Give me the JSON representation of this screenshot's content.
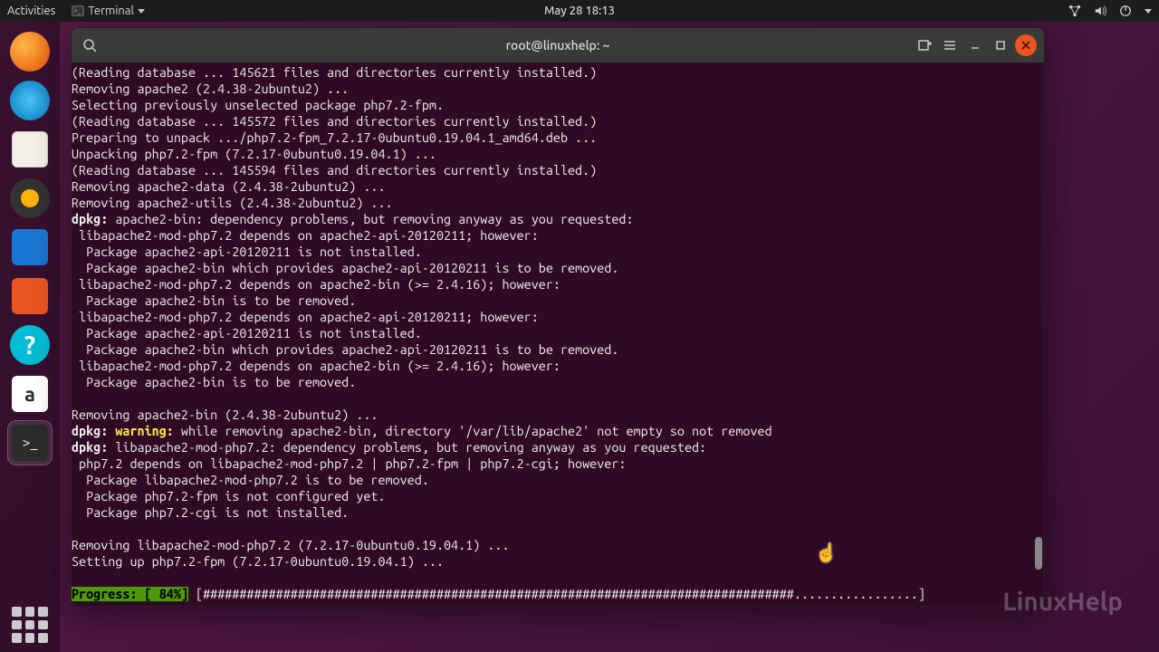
{
  "topbar": {
    "activities": "Activities",
    "app_name": "Terminal",
    "datetime": "May 28  18:13"
  },
  "dock": {
    "help_glyph": "?",
    "amazon_glyph": "a",
    "term_glyph": ">_"
  },
  "terminal": {
    "title": "root@linuxhelp: ~",
    "lines": {
      "l01": "(Reading database ... 145621 files and directories currently installed.)",
      "l02": "Removing apache2 (2.4.38-2ubuntu2) ...",
      "l03": "Selecting previously unselected package php7.2-fpm.",
      "l04": "(Reading database ... 145572 files and directories currently installed.)",
      "l05": "Preparing to unpack .../php7.2-fpm_7.2.17-0ubuntu0.19.04.1_amd64.deb ...",
      "l06": "Unpacking php7.2-fpm (7.2.17-0ubuntu0.19.04.1) ...",
      "l07": "(Reading database ... 145594 files and directories currently installed.)",
      "l08": "Removing apache2-data (2.4.38-2ubuntu2) ...",
      "l09": "Removing apache2-utils (2.4.38-2ubuntu2) ...",
      "l10a": "dpkg:",
      "l10b": " apache2-bin: dependency problems, but removing anyway as you requested:",
      "l11": " libapache2-mod-php7.2 depends on apache2-api-20120211; however:",
      "l12": "  Package apache2-api-20120211 is not installed.",
      "l13": "  Package apache2-bin which provides apache2-api-20120211 is to be removed.",
      "l14": " libapache2-mod-php7.2 depends on apache2-bin (>= 2.4.16); however:",
      "l15": "  Package apache2-bin is to be removed.",
      "l16": " libapache2-mod-php7.2 depends on apache2-api-20120211; however:",
      "l17": "  Package apache2-api-20120211 is not installed.",
      "l18": "  Package apache2-bin which provides apache2-api-20120211 is to be removed.",
      "l19": " libapache2-mod-php7.2 depends on apache2-bin (>= 2.4.16); however:",
      "l20": "  Package apache2-bin is to be removed.",
      "l21": "",
      "l22": "Removing apache2-bin (2.4.38-2ubuntu2) ...",
      "l23a": "dpkg: ",
      "l23b": "warning:",
      "l23c": " while removing apache2-bin, directory '/var/lib/apache2' not empty so not removed",
      "l24a": "dpkg:",
      "l24b": " libapache2-mod-php7.2: dependency problems, but removing anyway as you requested:",
      "l25": " php7.2 depends on libapache2-mod-php7.2 | php7.2-fpm | php7.2-cgi; however:",
      "l26": "  Package libapache2-mod-php7.2 is to be removed.",
      "l27": "  Package php7.2-fpm is not configured yet.",
      "l28": "  Package php7.2-cgi is not installed.",
      "l29": "",
      "l30": "Removing libapache2-mod-php7.2 (7.2.17-0ubuntu0.19.04.1) ...",
      "l31": "Setting up php7.2-fpm (7.2.17-0ubuntu0.19.04.1) ...",
      "progress_label": "Progress: [ 84%]",
      "progress_bar": " [#################################################################################.................] "
    }
  },
  "watermark": "LinuxHelp"
}
